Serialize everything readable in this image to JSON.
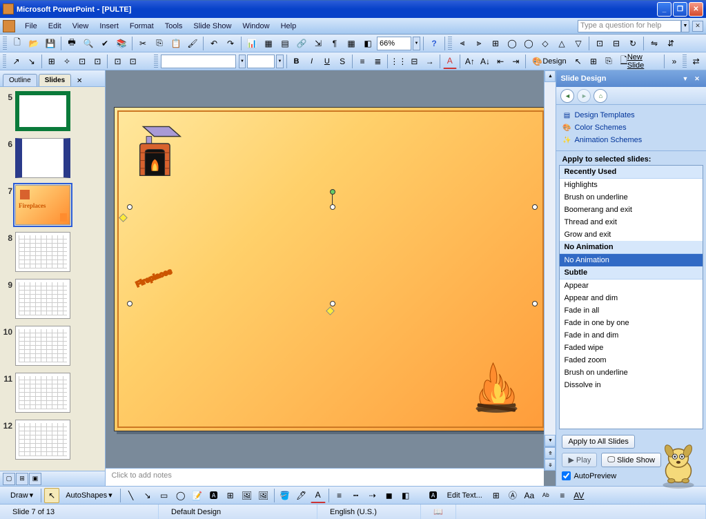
{
  "titlebar": {
    "app": "Microsoft PowerPoint",
    "doc": "[PULTE]"
  },
  "menu": {
    "file": "File",
    "edit": "Edit",
    "view": "View",
    "insert": "Insert",
    "format": "Format",
    "tools": "Tools",
    "slideshow": "Slide Show",
    "window": "Window",
    "help": "Help"
  },
  "help_placeholder": "Type a question for help",
  "zoom": "66%",
  "design_btn": "Design",
  "new_slide_btn": "New Slide",
  "thumbs": {
    "tab_outline": "Outline",
    "tab_slides": "Slides",
    "items": [
      {
        "n": "5",
        "kind": "green"
      },
      {
        "n": "6",
        "kind": "blue"
      },
      {
        "n": "7",
        "kind": "fire",
        "selected": true,
        "label": "Fireplaces"
      },
      {
        "n": "8",
        "kind": "wire"
      },
      {
        "n": "9",
        "kind": "wire"
      },
      {
        "n": "10",
        "kind": "wire"
      },
      {
        "n": "11",
        "kind": "wire"
      },
      {
        "n": "12",
        "kind": "wire"
      }
    ]
  },
  "slide": {
    "wordart": "Fireplaces"
  },
  "notes_placeholder": "Click to add notes",
  "taskpane": {
    "title": "Slide Design",
    "link_templates": "Design Templates",
    "link_colors": "Color Schemes",
    "link_anim": "Animation Schemes",
    "apply_label": "Apply to selected slides:",
    "groups": [
      {
        "header": "Recently Used",
        "items": [
          "Highlights",
          "Brush on underline",
          "Boomerang and exit",
          "Thread and exit",
          "Grow and exit"
        ]
      },
      {
        "header": "No Animation",
        "items": [
          "No Animation"
        ],
        "selected": 0
      },
      {
        "header": "Subtle",
        "items": [
          "Appear",
          "Appear and dim",
          "Fade in all",
          "Fade in one by one",
          "Fade in and dim",
          "Faded wipe",
          "Faded zoom",
          "Brush on underline",
          "Dissolve in"
        ]
      }
    ],
    "apply_all": "Apply to All Slides",
    "play": "Play",
    "slideshow": "Slide Show",
    "autopreview": "AutoPreview"
  },
  "drawbar": {
    "draw": "Draw",
    "autoshapes": "AutoShapes",
    "edit_text": "Edit Text..."
  },
  "status": {
    "slide": "Slide 7 of 13",
    "design": "Default Design",
    "lang": "English (U.S.)"
  }
}
